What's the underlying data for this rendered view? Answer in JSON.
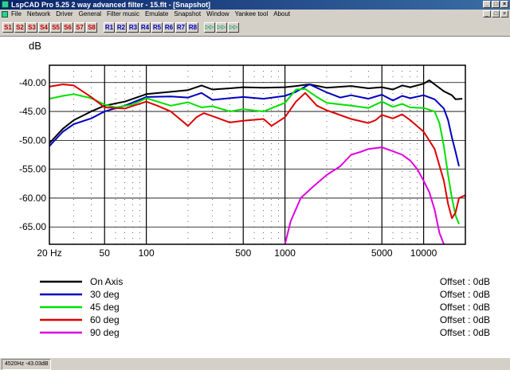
{
  "window": {
    "title": "LspCAD Pro 5.25 2 way advanced filter - 15.flt - [Snapshot]",
    "controls": [
      "_",
      "□",
      "×"
    ]
  },
  "menu": [
    "File",
    "Network",
    "Driver",
    "General",
    "Filter music",
    "Emulate",
    "Snapshot",
    "Window",
    "Yankee tool",
    "About"
  ],
  "toolbar": {
    "s_buttons": [
      "S1",
      "S2",
      "S3",
      "S4",
      "S5",
      "S6",
      "S7",
      "S8"
    ],
    "r_buttons": [
      "R1",
      "R2",
      "R3",
      "R4",
      "R5",
      "R6",
      "R7",
      "R8"
    ],
    "tool_icons": [
      "snapshot-tool-1-icon",
      "snapshot-tool-2-icon",
      "snapshot-tool-3-icon"
    ]
  },
  "status": {
    "readout": "4520Hz  -43.03dB"
  },
  "chart_data": {
    "type": "line",
    "ylabel": "dB",
    "xlim": [
      20,
      20000
    ],
    "ylim": [
      -68,
      -37
    ],
    "xscale": "log",
    "yticks": [
      -40,
      -45,
      -50,
      -55,
      -60,
      -65
    ],
    "ytick_labels": [
      "-40.00",
      "-45.00",
      "-50.00",
      "-55.00",
      "-60.00",
      "-65.00"
    ],
    "xtick_labels": [
      {
        "value": 20,
        "label": "20 Hz"
      },
      {
        "value": 50,
        "label": "50"
      },
      {
        "value": 100,
        "label": "100"
      },
      {
        "value": 500,
        "label": "500"
      },
      {
        "value": 1000,
        "label": "1000"
      },
      {
        "value": 5000,
        "label": "5000"
      },
      {
        "value": 10000,
        "label": "10000"
      }
    ],
    "grid": true,
    "series": [
      {
        "name": "On Axis",
        "color": "#000000",
        "offset": "Offset : 0dB",
        "points": [
          [
            20,
            -50.5
          ],
          [
            25,
            -48
          ],
          [
            30,
            -46.5
          ],
          [
            40,
            -45
          ],
          [
            50,
            -44
          ],
          [
            70,
            -43.3
          ],
          [
            100,
            -42
          ],
          [
            150,
            -41.6
          ],
          [
            200,
            -41.3
          ],
          [
            250,
            -40.5
          ],
          [
            300,
            -41.2
          ],
          [
            400,
            -41
          ],
          [
            500,
            -40.8
          ],
          [
            700,
            -40.9
          ],
          [
            1000,
            -40.8
          ],
          [
            1200,
            -40.6
          ],
          [
            1500,
            -40.3
          ],
          [
            2000,
            -40.9
          ],
          [
            3000,
            -40.6
          ],
          [
            4000,
            -41
          ],
          [
            5000,
            -40.8
          ],
          [
            6000,
            -41.2
          ],
          [
            7000,
            -40.5
          ],
          [
            8000,
            -40.8
          ],
          [
            10000,
            -40.2
          ],
          [
            11000,
            -39.6
          ],
          [
            12000,
            -40.3
          ],
          [
            14000,
            -41.5
          ],
          [
            16000,
            -42.2
          ],
          [
            17000,
            -42.9
          ],
          [
            19000,
            -42.8
          ]
        ]
      },
      {
        "name": "30 deg",
        "color": "#0000c0",
        "offset": "Offset : 0dB",
        "points": [
          [
            20,
            -51
          ],
          [
            25,
            -48.5
          ],
          [
            30,
            -47.2
          ],
          [
            40,
            -46.2
          ],
          [
            50,
            -45
          ],
          [
            70,
            -44
          ],
          [
            100,
            -42.5
          ],
          [
            150,
            -42.4
          ],
          [
            200,
            -42.6
          ],
          [
            250,
            -41.8
          ],
          [
            300,
            -43
          ],
          [
            400,
            -42.7
          ],
          [
            500,
            -42.5
          ],
          [
            700,
            -42.8
          ],
          [
            1000,
            -42.3
          ],
          [
            1200,
            -41.6
          ],
          [
            1500,
            -40.3
          ],
          [
            2000,
            -41.7
          ],
          [
            2500,
            -42.6
          ],
          [
            3000,
            -42.2
          ],
          [
            4000,
            -42.8
          ],
          [
            5000,
            -42.1
          ],
          [
            6000,
            -43.1
          ],
          [
            7000,
            -42.3
          ],
          [
            8000,
            -42.7
          ],
          [
            10000,
            -42.2
          ],
          [
            12000,
            -42.9
          ],
          [
            14000,
            -44.5
          ],
          [
            15000,
            -46.5
          ],
          [
            16000,
            -49.5
          ],
          [
            17000,
            -52
          ],
          [
            18000,
            -54.5
          ]
        ]
      },
      {
        "name": "45 deg",
        "color": "#00e000",
        "offset": "Offset : 0dB",
        "points": [
          [
            20,
            -42.8
          ],
          [
            25,
            -42.3
          ],
          [
            30,
            -42
          ],
          [
            40,
            -42.7
          ],
          [
            50,
            -43.8
          ],
          [
            60,
            -44.3
          ],
          [
            80,
            -43.8
          ],
          [
            100,
            -42.7
          ],
          [
            150,
            -44
          ],
          [
            200,
            -43.4
          ],
          [
            250,
            -44.3
          ],
          [
            300,
            -44.1
          ],
          [
            400,
            -45
          ],
          [
            500,
            -44.6
          ],
          [
            700,
            -45
          ],
          [
            1000,
            -43.5
          ],
          [
            1200,
            -41.2
          ],
          [
            1400,
            -41.1
          ],
          [
            1700,
            -42.5
          ],
          [
            2000,
            -43.5
          ],
          [
            3000,
            -44
          ],
          [
            4000,
            -44.4
          ],
          [
            5000,
            -43.3
          ],
          [
            6000,
            -44.2
          ],
          [
            7000,
            -43.7
          ],
          [
            8000,
            -44.3
          ],
          [
            10000,
            -44.4
          ],
          [
            12000,
            -45
          ],
          [
            13000,
            -47
          ],
          [
            14000,
            -51
          ],
          [
            15000,
            -56
          ],
          [
            16000,
            -60
          ],
          [
            17000,
            -63
          ],
          [
            18000,
            -64.5
          ]
        ]
      },
      {
        "name": "60 deg",
        "color": "#e00000",
        "offset": "Offset : 0dB",
        "points": [
          [
            20,
            -40.7
          ],
          [
            25,
            -40.3
          ],
          [
            30,
            -40.5
          ],
          [
            40,
            -42.5
          ],
          [
            50,
            -44.3
          ],
          [
            70,
            -44.5
          ],
          [
            100,
            -43.3
          ],
          [
            120,
            -44
          ],
          [
            150,
            -45
          ],
          [
            200,
            -47.5
          ],
          [
            230,
            -46
          ],
          [
            260,
            -45.3
          ],
          [
            300,
            -45.8
          ],
          [
            400,
            -46.9
          ],
          [
            500,
            -46.6
          ],
          [
            700,
            -46.3
          ],
          [
            800,
            -47.5
          ],
          [
            1000,
            -46
          ],
          [
            1200,
            -43.3
          ],
          [
            1400,
            -41.8
          ],
          [
            1700,
            -44
          ],
          [
            2000,
            -44.8
          ],
          [
            3000,
            -46.3
          ],
          [
            4000,
            -47
          ],
          [
            4500,
            -46.5
          ],
          [
            5000,
            -45.6
          ],
          [
            6000,
            -46.2
          ],
          [
            7000,
            -45.5
          ],
          [
            8000,
            -46.5
          ],
          [
            10000,
            -48.5
          ],
          [
            12000,
            -51.5
          ],
          [
            14000,
            -57
          ],
          [
            15000,
            -61
          ],
          [
            16000,
            -63.5
          ],
          [
            17000,
            -62.5
          ],
          [
            18000,
            -60
          ],
          [
            20000,
            -59.5
          ]
        ]
      },
      {
        "name": "90 deg",
        "color": "#e000e0",
        "offset": "Offset : 0dB",
        "points": [
          [
            1000,
            -68
          ],
          [
            1100,
            -64
          ],
          [
            1300,
            -60
          ],
          [
            1600,
            -58
          ],
          [
            2000,
            -56
          ],
          [
            2500,
            -54.5
          ],
          [
            3000,
            -52.5
          ],
          [
            3500,
            -52
          ],
          [
            4000,
            -51.5
          ],
          [
            5000,
            -51.2
          ],
          [
            6000,
            -51.9
          ],
          [
            7000,
            -52.5
          ],
          [
            8000,
            -53.5
          ],
          [
            9000,
            -55
          ],
          [
            10000,
            -57
          ],
          [
            11000,
            -59
          ],
          [
            12000,
            -62
          ],
          [
            13000,
            -66
          ],
          [
            14000,
            -68
          ]
        ]
      }
    ]
  }
}
